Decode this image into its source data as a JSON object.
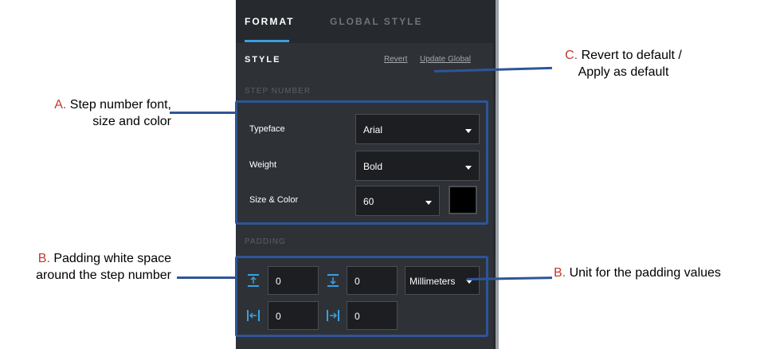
{
  "tabs": [
    {
      "label": "FORMAT",
      "active": true
    },
    {
      "label": "GLOBAL STYLE",
      "active": false
    }
  ],
  "style": {
    "heading": "STYLE",
    "revert_label": "Revert",
    "update_global_label": "Update Global"
  },
  "step_number": {
    "section_label": "STEP NUMBER",
    "typeface": {
      "label": "Typeface",
      "value": "Arial"
    },
    "weight": {
      "label": "Weight",
      "value": "Bold"
    },
    "size_color": {
      "label": "Size & Color",
      "size": "60",
      "color": "#000000"
    }
  },
  "padding": {
    "section_label": "PADDING",
    "top": "0",
    "bottom": "0",
    "left": "0",
    "right": "0",
    "unit": "Millimeters"
  },
  "annotations": {
    "a": {
      "letter": "A.",
      "line1": " Step number font,",
      "line2": "size and color"
    },
    "b_left": {
      "letter": "B.",
      "line1": " Padding white space",
      "line2": "around the step number"
    },
    "c": {
      "letter": "C.",
      "line1": " Revert to default /",
      "line2": "Apply as default"
    },
    "b_right": {
      "letter": "B.",
      "text": " Unit for the padding values"
    }
  },
  "colors": {
    "accent": "#3aa0e0",
    "annotation_box": "#2f5597",
    "annotation_letter": "#c0392b",
    "panel_bg": "#2e3237"
  }
}
